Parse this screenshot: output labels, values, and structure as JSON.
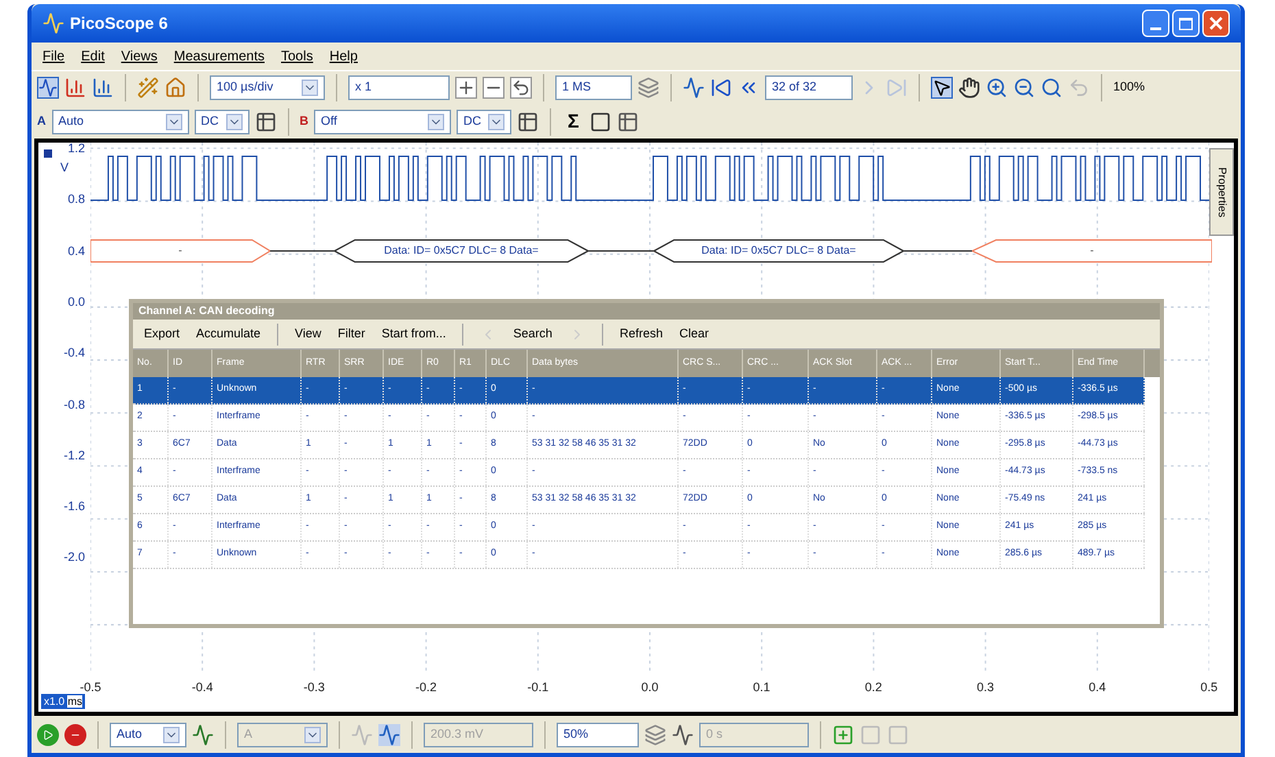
{
  "window": {
    "title": "PicoScope 6"
  },
  "menu": [
    "File",
    "Edit",
    "Views",
    "Measurements",
    "Tools",
    "Help"
  ],
  "toolbar": {
    "timebase": "100 µs/div",
    "multiplier": "x 1",
    "samples": "1 MS",
    "buffer": "32 of 32",
    "zoom": "100%"
  },
  "channels": [
    {
      "label": "A",
      "range": "Auto",
      "coupling": "DC",
      "enabled": true
    },
    {
      "label": "B",
      "range": "Off",
      "coupling": "DC",
      "enabled": false
    }
  ],
  "math_symbol": "Σ",
  "scope": {
    "y_unit": "V",
    "y_ticks": [
      "1.2",
      "0.8",
      "0.4",
      "0.0",
      "-0.4",
      "-0.8",
      "-1.2",
      "-1.6",
      "-2.0"
    ],
    "x_ticks": [
      "-0.5",
      "-0.4",
      "-0.3",
      "-0.2",
      "-0.1",
      "0.0",
      "0.1",
      "0.2",
      "0.3",
      "0.4",
      "0.5"
    ],
    "x_scale": "x1.0",
    "x_unit": "ms",
    "side_tab": "Properties",
    "decode_bubbles": [
      {
        "kind": "idle",
        "text": "-"
      },
      {
        "kind": "data",
        "text": "Data: ID= 0x5C7 DLC= 8 Data="
      },
      {
        "kind": "data",
        "text": "Data: ID= 0x5C7 DLC= 8 Data="
      },
      {
        "kind": "idle",
        "text": "-"
      }
    ]
  },
  "decode_window": {
    "title": "Channel A: CAN decoding",
    "actions": [
      "Export",
      "Accumulate",
      "View",
      "Filter",
      "Start from...",
      "Search",
      "Refresh",
      "Clear"
    ],
    "columns": [
      "No.",
      "ID",
      "Frame",
      "RTR",
      "SRR",
      "IDE",
      "R0",
      "R1",
      "DLC",
      "Data bytes",
      "CRC S...",
      "CRC ...",
      "ACK Slot",
      "ACK ...",
      "Error",
      "Start T...",
      "End Time"
    ],
    "rows": [
      {
        "selected": true,
        "cells": [
          "1",
          "-",
          "Unknown",
          "-",
          "-",
          "-",
          "-",
          "-",
          "0",
          "-",
          "-",
          "-",
          "-",
          "-",
          "None",
          "-500 µs",
          "-336.5 µs"
        ]
      },
      {
        "selected": false,
        "cells": [
          "2",
          "-",
          "Interframe",
          "-",
          "-",
          "-",
          "-",
          "-",
          "0",
          "-",
          "-",
          "-",
          "-",
          "-",
          "None",
          "-336.5 µs",
          "-298.5 µs"
        ]
      },
      {
        "selected": false,
        "cells": [
          "3",
          "6C7",
          "Data",
          "1",
          "-",
          "1",
          "1",
          "-",
          "8",
          "53 31 32 58 46 35 31 32",
          "72DD",
          "0",
          "No",
          "0",
          "None",
          "-295.8 µs",
          "-44.73 µs"
        ]
      },
      {
        "selected": false,
        "cells": [
          "4",
          "-",
          "Interframe",
          "-",
          "-",
          "-",
          "-",
          "-",
          "0",
          "-",
          "-",
          "-",
          "-",
          "-",
          "None",
          "-44.73 µs",
          "-733.5 ns"
        ]
      },
      {
        "selected": false,
        "cells": [
          "5",
          "6C7",
          "Data",
          "1",
          "-",
          "1",
          "1",
          "-",
          "8",
          "53 31 32 58 46 35 31 32",
          "72DD",
          "0",
          "No",
          "0",
          "None",
          "-75.49 ns",
          "241 µs"
        ]
      },
      {
        "selected": false,
        "cells": [
          "6",
          "-",
          "Interframe",
          "-",
          "-",
          "-",
          "-",
          "-",
          "0",
          "-",
          "-",
          "-",
          "-",
          "-",
          "None",
          "241 µs",
          "285 µs"
        ]
      },
      {
        "selected": false,
        "cells": [
          "7",
          "-",
          "Unknown",
          "-",
          "-",
          "-",
          "-",
          "-",
          "0",
          "-",
          "-",
          "-",
          "-",
          "-",
          "None",
          "285.6 µs",
          "489.7 µs"
        ]
      }
    ]
  },
  "trigger_bar": {
    "mode": "Auto",
    "source": {
      "value": "A",
      "disabled": true
    },
    "threshold": {
      "value": "200.3 mV",
      "disabled": true
    },
    "pretrigger": {
      "value": "50%",
      "disabled": false
    },
    "delay": {
      "value": "0 s",
      "disabled": true
    }
  }
}
